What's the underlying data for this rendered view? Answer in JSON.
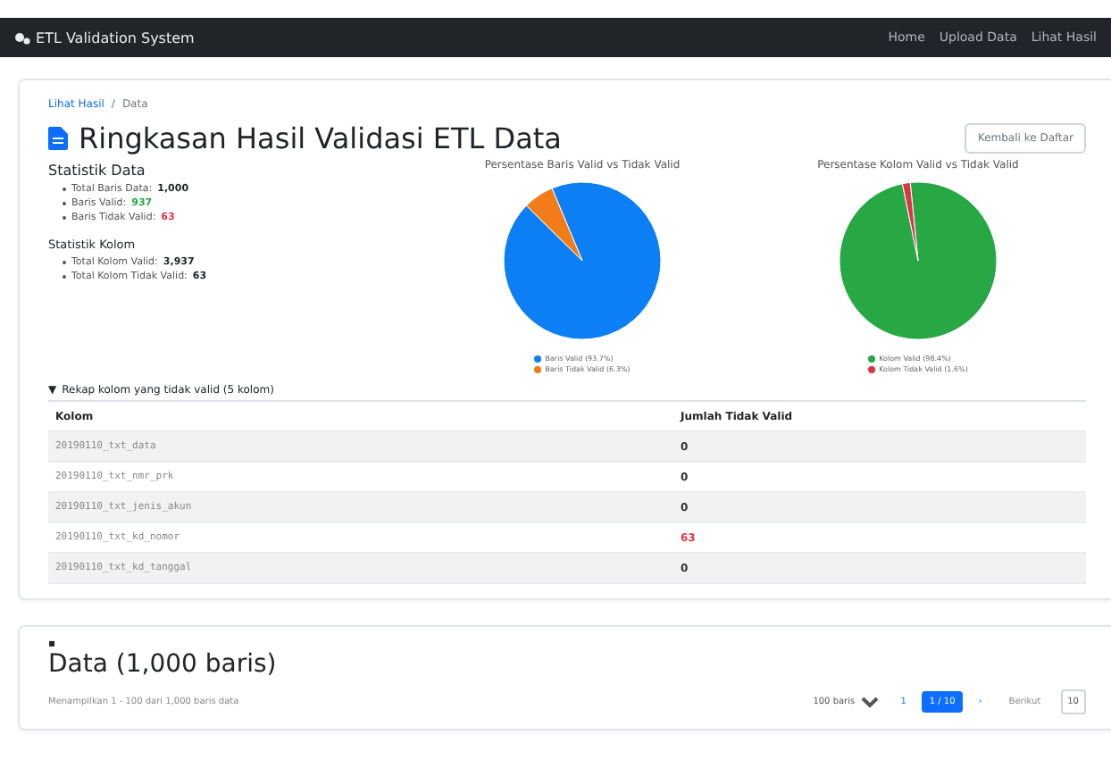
{
  "navbar": {
    "brand": "ETL Validation System",
    "links": [
      {
        "label": "Home"
      },
      {
        "label": "Upload Data"
      },
      {
        "label": "Lihat Hasil"
      }
    ]
  },
  "breadcrumb": {
    "link": "Lihat Hasil",
    "separator": "/",
    "current": "Data"
  },
  "summary": {
    "title": "Ringkasan Hasil Validasi ETL Data",
    "back_button": "Kembali ke Daftar",
    "row_stats": {
      "heading": "Statistik Data",
      "items": [
        {
          "label": "Total Baris Data:",
          "value": "1,000",
          "kind": "bold"
        },
        {
          "label": "Baris Valid:",
          "value": "937",
          "kind": "valid"
        },
        {
          "label": "Baris Tidak Valid:",
          "value": "63",
          "kind": "invalid"
        }
      ]
    },
    "column_stats": {
      "heading": "Statistik Kolom",
      "items": [
        {
          "label": "Total Kolom Valid:",
          "value": "3,937",
          "kind": "bold"
        },
        {
          "label": "Total Kolom Tidak Valid:",
          "value": "63",
          "kind": "bold"
        }
      ]
    },
    "charts": [
      {
        "chart_data": {
          "type": "pie",
          "title": "Persentase Baris Valid vs Tidak Valid",
          "categories": [
            "Baris Valid (93.7%)",
            "Baris Tidak Valid (6.3%)"
          ],
          "values": [
            93.7,
            6.3
          ],
          "colors": [
            "#0d7ff5",
            "#f27c1a"
          ],
          "legend": "bottom"
        }
      },
      {
        "chart_data": {
          "type": "pie",
          "title": "Persentase Kolom Valid vs Tidak Valid",
          "categories": [
            "Kolom Valid (98.4%)",
            "Kolom Tidak Valid (1.6%)"
          ],
          "values": [
            98.4,
            1.6
          ],
          "colors": [
            "#28a745",
            "#dc3545"
          ],
          "legend": "bottom"
        }
      }
    ],
    "invalid_columns": {
      "toggle": "▼",
      "title": "Rekap kolom yang tidak valid (5 kolom)",
      "expanded": true,
      "columns": [
        "Kolom",
        "Jumlah Tidak Valid"
      ],
      "rows": [
        {
          "name": "20190110_txt_data",
          "count": "0",
          "invalid": false
        },
        {
          "name": "20190110_txt_nmr_prk",
          "count": "0",
          "invalid": false
        },
        {
          "name": "20190110_txt_jenis_akun",
          "count": "0",
          "invalid": false
        },
        {
          "name": "20190110_txt_kd_nomor",
          "count": "63",
          "invalid": true
        },
        {
          "name": "20190110_txt_kd_tanggal",
          "count": "0",
          "invalid": false
        }
      ]
    }
  },
  "data_section": {
    "marker": "▪",
    "title": "Data (1,000 baris)",
    "subtitle": "Menampilkan 1 - 100 dari 1,000 baris data",
    "page_size": "100 baris",
    "pages": [
      {
        "label": "1",
        "selected": false
      },
      {
        "label": "1 / 10",
        "selected": true
      },
      {
        "label": "›",
        "selected": false
      }
    ],
    "next": "Berikut",
    "last": "10"
  }
}
